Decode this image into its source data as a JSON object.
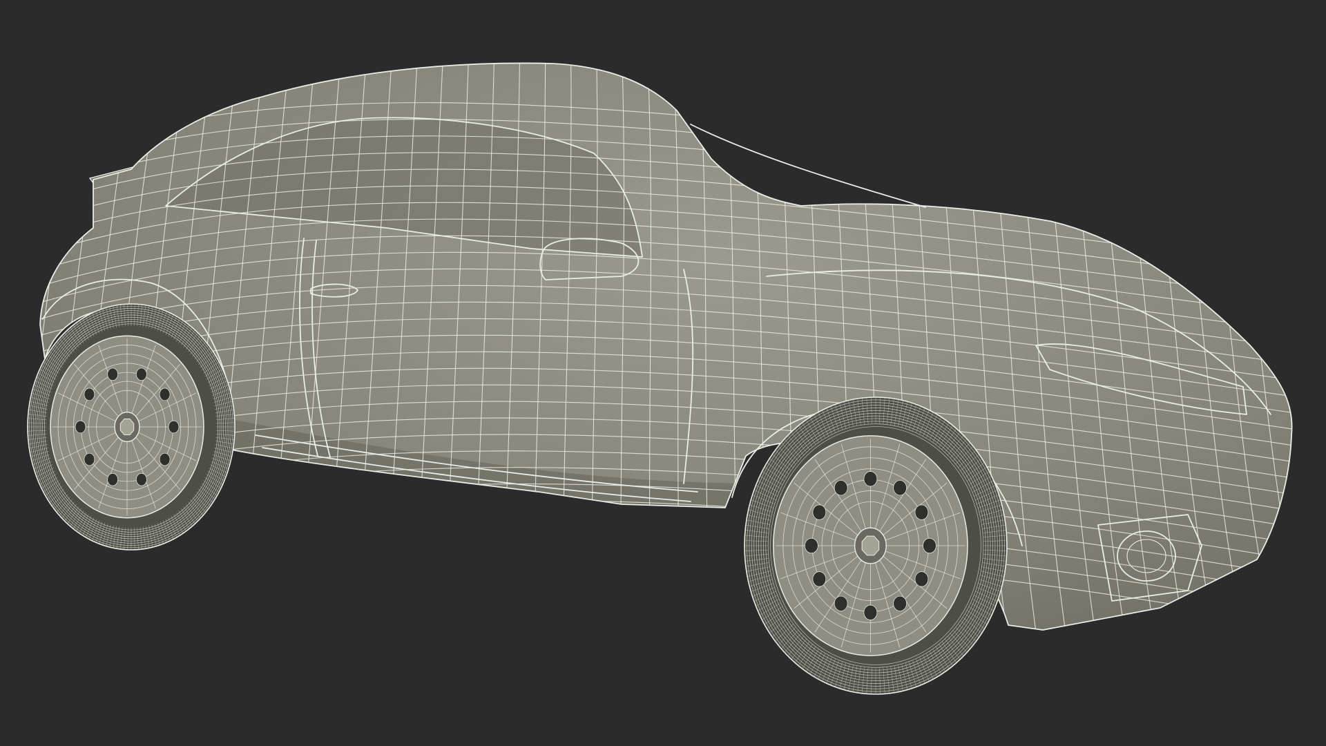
{
  "scene": {
    "subject": "car-3d-wireframe-render",
    "colors": {
      "background": "#2b2b2b",
      "body_fill": "#8a8a7e",
      "body_shade": "#6f6f65",
      "body_light": "#a3a396",
      "wire": "#ecece6",
      "tire": "#6a6a62",
      "tire_dark": "#4e4e48",
      "rim": "#8e8e84"
    }
  }
}
